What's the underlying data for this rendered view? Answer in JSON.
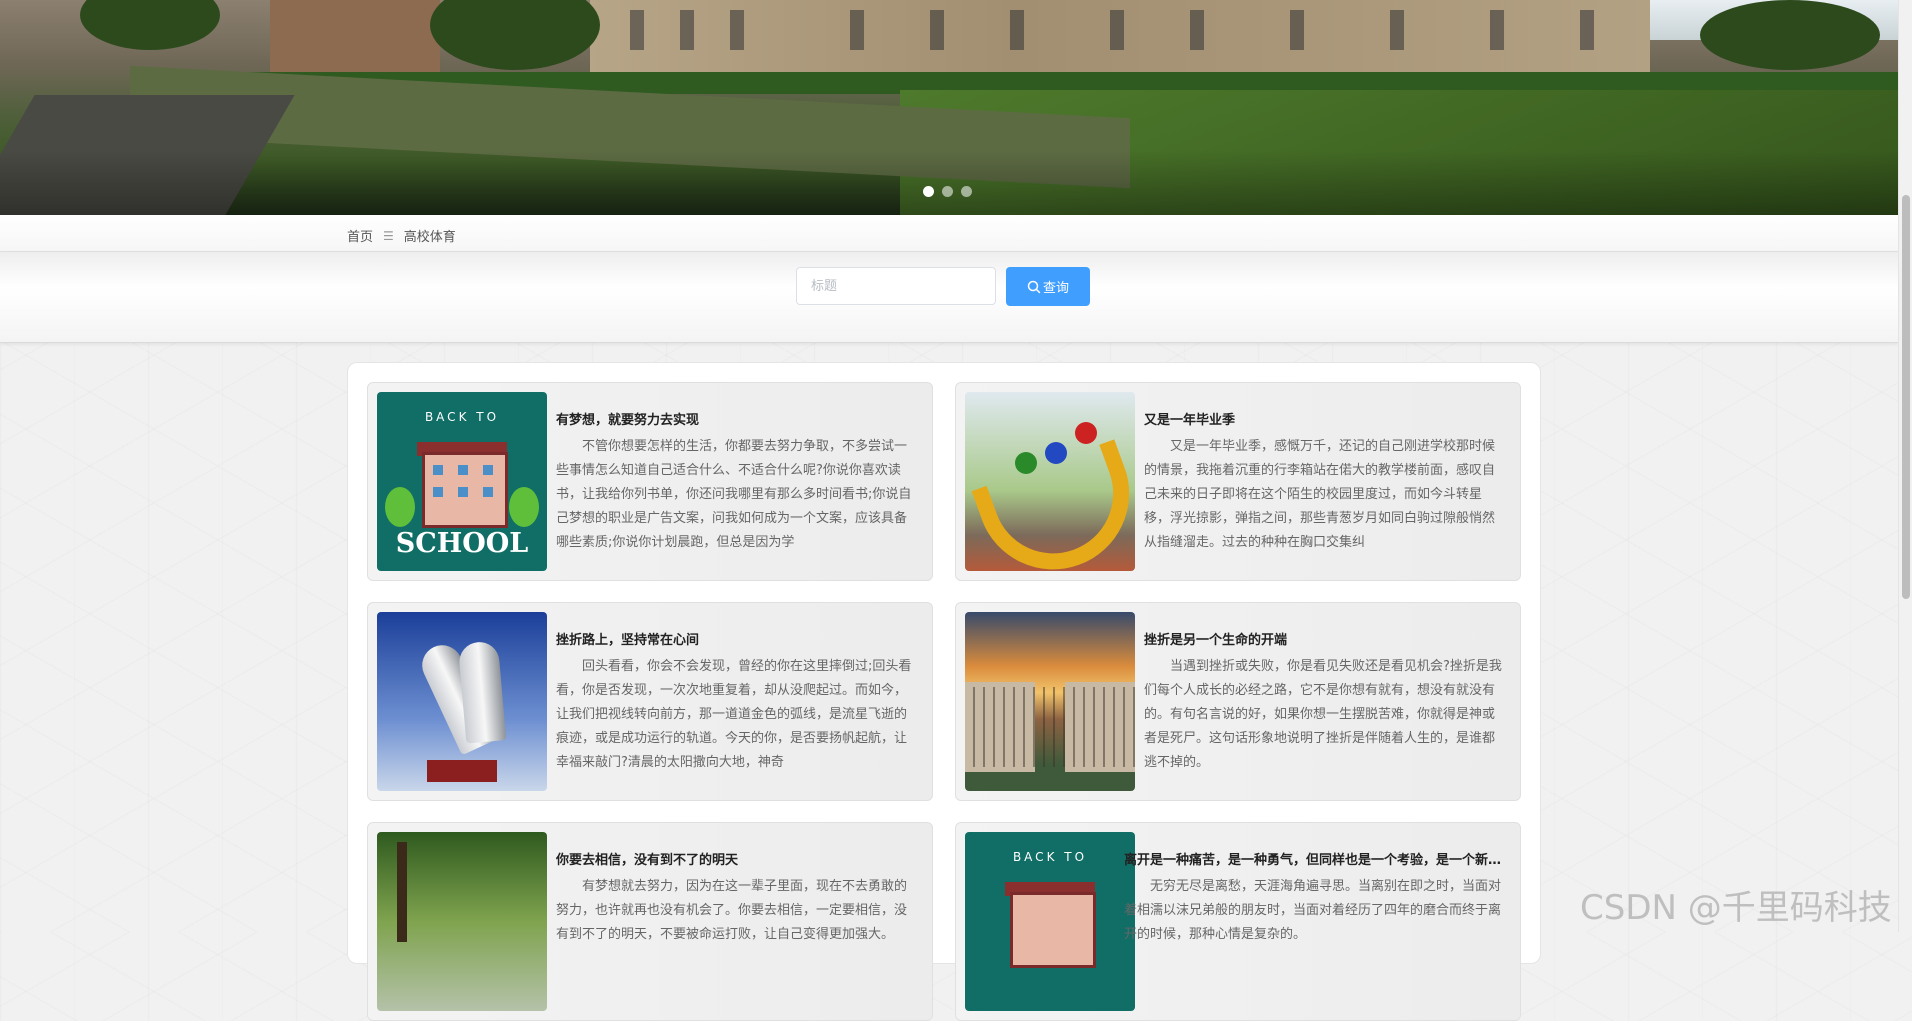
{
  "carousel": {
    "slide_count": 3,
    "active_index": 0
  },
  "breadcrumb": {
    "home": "首页",
    "separator": "☰",
    "current": "高校体育"
  },
  "search": {
    "placeholder": "标题",
    "value": "",
    "button_label": "查询",
    "button_color": "#409eff"
  },
  "articles": [
    {
      "title": "有梦想，就要努力去实现",
      "body": "不管你想要怎样的生活，你都要去努力争取，不多尝试一些事情怎么知道自己适合什么、不适合什么呢?你说你喜欢读书，让我给你列书单，你还问我哪里有那么多时间看书;你说自己梦想的职业是广告文案，问我如何成为一个文案，应该具备哪些素质;你说你计划晨跑，但总是因为学",
      "image_caption_top": "BACK TO",
      "image_caption_bottom": "SCHOOL"
    },
    {
      "title": "又是一年毕业季",
      "body": "又是一年毕业季，感慨万千，还记的自己刚进学校那时候的情景，我拖着沉重的行李箱站在偌大的教学楼前面，感叹自己未来的日子即将在这个陌生的校园里度过，而如今斗转星移，浮光掠影，弹指之间，那些青葱岁月如同白驹过隙般悄然从指缝溜走。过去的种种在胸口交集纠"
    },
    {
      "title": "挫折路上，坚持常在心间",
      "body": "回头看看，你会不会发现，曾经的你在这里摔倒过;回头看看，你是否发现，一次次地重复着，却从没爬起过。而如今，让我们把视线转向前方，那一道道金色的弧线，是流星飞逝的痕迹，或是成功运行的轨道。今天的你，是否要扬帆起航，让幸福来敲门?清晨的太阳撒向大地，神奇"
    },
    {
      "title": "挫折是另一个生命的开端",
      "body": "当遇到挫折或失败，你是看见失败还是看见机会?挫折是我们每个人成长的必经之路，它不是你想有就有，想没有就没有的。有句名言说的好，如果你想一生摆脱苦难，你就得是神或者是死尸。这句话形象地说明了挫折是伴随着人生的，是谁都逃不掉的。"
    },
    {
      "title": "你要去相信，没有到不了的明天",
      "body": "有梦想就去努力，因为在这一辈子里面，现在不去勇敢的努力，也许就再也没有机会了。你要去相信，一定要相信，没有到不了的明天，不要被命运打败，让自己变得更加强大。"
    },
    {
      "title": "离开是一种痛苦，是一种勇气，但同样也是一个考验，是一个新的开始",
      "body": "无穷无尽是离愁，天涯海角遍寻思。当离别在即之时，当面对着相濡以沫兄弟般的朋友时，当面对着经历了四年的磨合而终于离开的时候，那种心情是复杂的。",
      "image_caption_top": "BACK TO"
    }
  ],
  "watermark": "CSDN @千里码科技"
}
